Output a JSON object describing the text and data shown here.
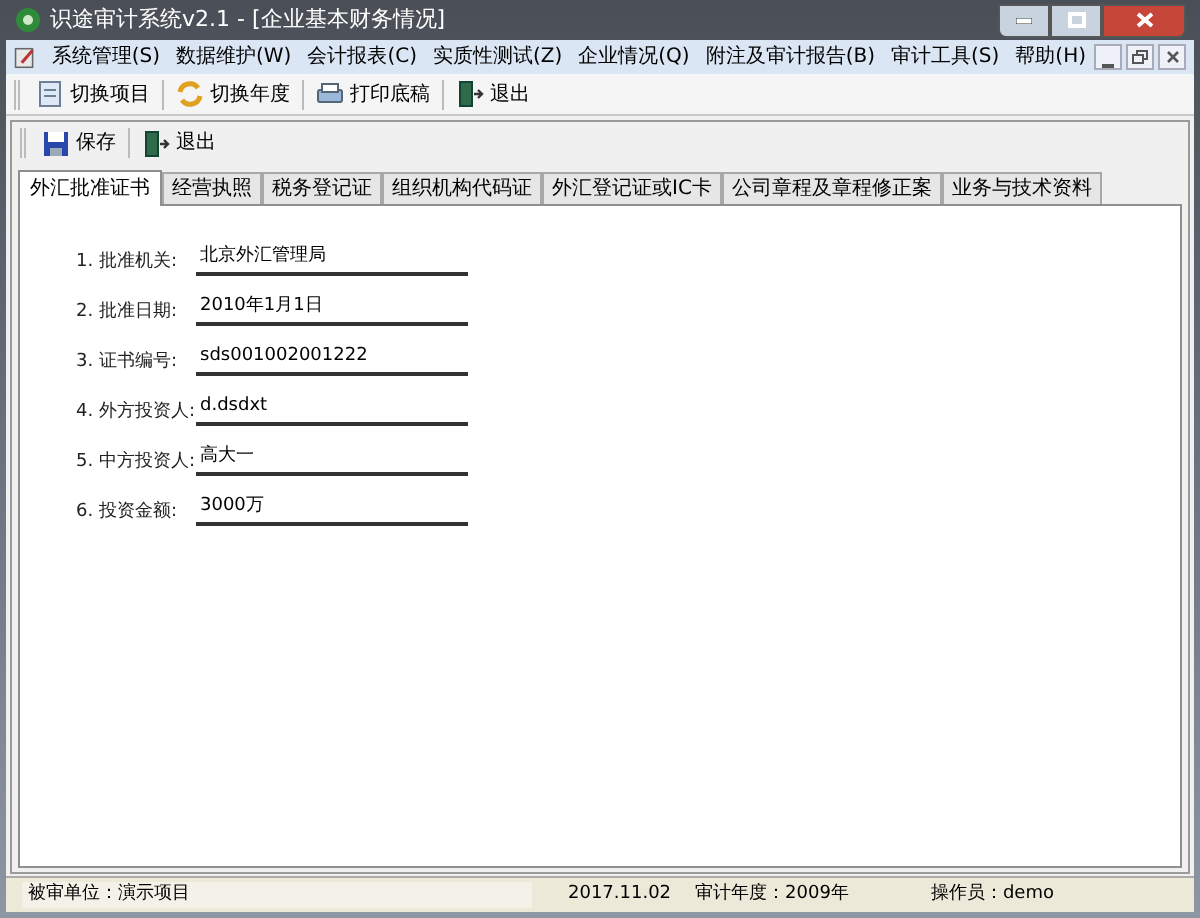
{
  "window": {
    "title": "识途审计系统v2.1 - [企业基本财务情况]"
  },
  "menu": [
    "系统管理(S)",
    "数据维护(W)",
    "会计报表(C)",
    "实质性测试(Z)",
    "企业情况(Q)",
    "附注及审计报告(B)",
    "审计工具(S)",
    "帮助(H)"
  ],
  "toolbar": [
    {
      "kind": "project",
      "label": "切换项目"
    },
    {
      "kind": "year",
      "label": "切换年度"
    },
    {
      "kind": "print",
      "label": "打印底稿"
    },
    {
      "kind": "exit",
      "label": "退出"
    }
  ],
  "form_toolbar": [
    {
      "kind": "save",
      "label": "保存"
    },
    {
      "kind": "exit",
      "label": "退出"
    }
  ],
  "tabs": [
    {
      "label": "外汇批准证书",
      "selected": true
    },
    {
      "label": "经营执照",
      "selected": false
    },
    {
      "label": "税务登记证",
      "selected": false
    },
    {
      "label": "组织机构代码证",
      "selected": false
    },
    {
      "label": "外汇登记证或IC卡",
      "selected": false
    },
    {
      "label": "公司章程及章程修正案",
      "selected": false
    },
    {
      "label": "业务与技术资料",
      "selected": false
    }
  ],
  "fields": [
    {
      "label": "1. 批准机关:",
      "value": "北京外汇管理局"
    },
    {
      "label": "2. 批准日期:",
      "value": "2010年1月1日"
    },
    {
      "label": "3. 证书编号:",
      "value": "sds001002001222"
    },
    {
      "label": "4. 外方投资人:",
      "value": "d.dsdxt"
    },
    {
      "label": "5. 中方投资人:",
      "value": "高大一"
    },
    {
      "label": "6. 投资金额:",
      "value": "3000万"
    }
  ],
  "status_bar": {
    "unit": "被审单位：演示项目",
    "date": "2017.11.02",
    "year": "审计年度：2009年",
    "operator": "操作员：demo"
  }
}
